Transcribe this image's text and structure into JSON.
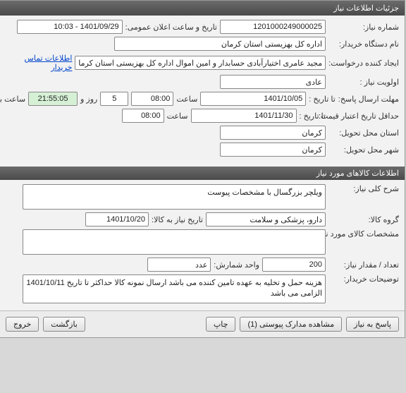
{
  "window": {
    "title": "جزئیات اطلاعات نیاز"
  },
  "need": {
    "number_label": "شماره نیاز:",
    "number": "1201000249000025",
    "announce_label": "تاریخ و ساعت اعلان عمومی:",
    "announce_datetime": "1401/09/29 - 10:03",
    "buyer_label": "نام دستگاه خریدار:",
    "buyer": "اداره کل بهزیستی استان کرمان",
    "creator_label": "ایجاد کننده درخواست:",
    "creator": "مجید عامری اختیارآبادی حسابدار و امین اموال اداره کل بهزیستی استان کرمان",
    "contact_link": "اطلاعات تماس خریدار",
    "priority_label": "اولویت نیاز :",
    "priority": "عادی",
    "reply_deadline_label": "مهلت ارسال پاسخ:",
    "to_date_label": "تا تاریخ :",
    "reply_date": "1401/10/05",
    "hour_label": "ساعت",
    "reply_hour": "08:00",
    "days_count": "5",
    "days_and": "روز و",
    "remaining_time": "21:55:05",
    "remaining_label": "ساعت باقی مانده",
    "price_validity_label": "حداقل تاریخ اعتبار قیمت:",
    "price_validity_date": "1401/11/30",
    "price_validity_hour": "08:00",
    "delivery_province_label": "استان محل تحویل:",
    "delivery_province": "کرمان",
    "delivery_city_label": "شهر محل تحویل:",
    "delivery_city": "کرمان"
  },
  "goods": {
    "header": "اطلاعات کالاهای مورد نیاز",
    "desc_label": "شرح کلی نیاز:",
    "desc": "ویلچر بزرگسال با مشخصات پیوست",
    "group_label": "گروه کالا:",
    "group": "دارو، پزشکی و سلامت",
    "need_date_label": "تاریخ نیاز به کالا:",
    "need_date": "1401/10/20",
    "spec_label": "مشخصات کالای مورد نیاز:",
    "spec": "",
    "qty_label": "تعداد / مقدار نیاز:",
    "qty": "200",
    "unit_label": "واحد شمارش:",
    "unit": "عدد",
    "buyer_notes_label": "توضیحات خریدار:",
    "buyer_notes": "هزینه حمل و تخلیه به عهده تامین کننده می باشد ارسال نمونه کالا حداکثر تا تاریخ 1401/10/11 الزامی  می باشد"
  },
  "buttons": {
    "reply": "پاسخ به نیاز",
    "attachments": "مشاهده مدارک پیوستی (1)",
    "print": "چاپ",
    "back": "بازگشت",
    "exit": "خروج"
  }
}
